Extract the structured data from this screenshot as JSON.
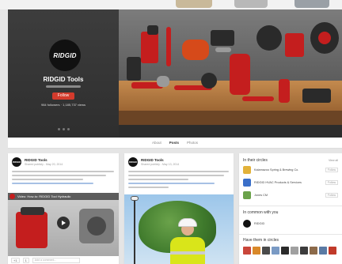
{
  "profile": {
    "logo_text": "RIDGID",
    "name": "RIDGID Tools",
    "follow_label": "Follow",
    "followers": "984 followers · 1,185,737 views"
  },
  "tabs": [
    {
      "label": "About"
    },
    {
      "label": "Posts",
      "active": true
    },
    {
      "label": "Photos"
    }
  ],
  "posts": [
    {
      "author": "RIDGID Tools",
      "time": "Shared publicly - May 20, 2014",
      "avatar_text": "RIDGID",
      "video_title": "Video: How-to: RIDGID Tool Hydraulic",
      "actions": {
        "plus_one": "+1",
        "share": "1",
        "comment_placeholder": "Add a comment..."
      }
    },
    {
      "author": "RIDGID Tools",
      "time": "Shared publicly - May 13, 2014",
      "avatar_text": "RIDGID"
    }
  ],
  "sidebar": {
    "in_circles_title": "In their circles",
    "in_circles_link": "View all",
    "circles": [
      {
        "name": "Kalamazoo Spring & Brewing Co.",
        "action": "Follow",
        "color": "#e2b23a"
      },
      {
        "name": "RIDGID HVAC Products & Services",
        "action": "Follow",
        "color": "#3a6fc9"
      },
      {
        "name": "Jones CM",
        "action": "Follow",
        "color": "#6aa24a"
      }
    ],
    "in_common_title": "In common with you",
    "in_common_person": "RIDGID",
    "have_them_title": "Have them in circles",
    "thumb_colors": [
      "#c9463a",
      "#d9892a",
      "#4a4a4a",
      "#7a9ac4",
      "#2b2b2b",
      "#a0a0a0",
      "#3c3c3c",
      "#8c6a4a",
      "#5a7aa4",
      "#c13a2a",
      "#6d6d6d"
    ]
  },
  "colors": {
    "brand_red": "#c41e1e",
    "follow_red": "#d33b2c"
  }
}
